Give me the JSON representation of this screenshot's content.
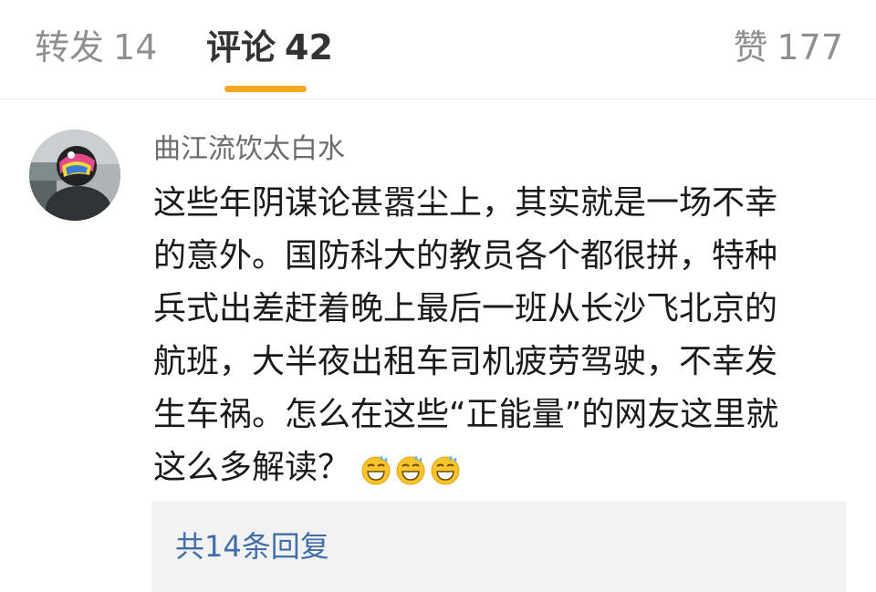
{
  "tabs": [
    {
      "label": "转发",
      "count": "14"
    },
    {
      "label": "评论",
      "count": "42"
    },
    {
      "label": "赞",
      "count": "177"
    }
  ],
  "colors": {
    "accent": "#f5a623",
    "link": "#3f6ea8",
    "text": "#1a1a1a",
    "muted": "#8f8f8f"
  },
  "comment": {
    "username": "曲江流饮太白水",
    "text_lines": [
      "这些年阴谋论甚嚣尘上，其实就是一场不幸",
      "的意外。国防科大的教员各个都很拼，特种",
      "兵式出差赶着晚上最后一班从长沙飞北京的",
      "航班，大半夜出租车司机疲劳驾驶，不幸发",
      "生车祸。怎么在这些“正能量”的网友这里就",
      "这么多解读？"
    ],
    "emojis": [
      "grinning-sweat-emoji",
      "grinning-sweat-emoji",
      "grinning-sweat-emoji"
    ],
    "replies_link": "共14条回复"
  }
}
